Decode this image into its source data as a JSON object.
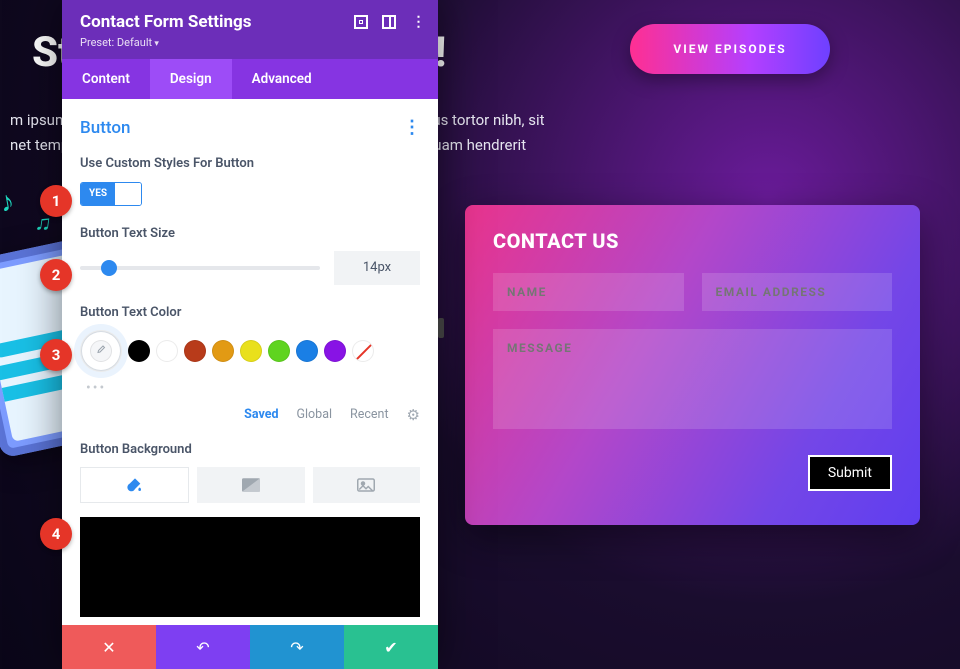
{
  "background": {
    "heading_left": "St",
    "heading_right": "lay!",
    "paragraph_line1_left": "m ipsum",
    "paragraph_line1_right": "rius tortor nibh, sit",
    "paragraph_line2_left": "net temp",
    "paragraph_line2_right": "quam hendrerit",
    "view_episodes": "VIEW EPISODES"
  },
  "contact": {
    "title": "CONTACT US",
    "name_placeholder": "NAME",
    "email_placeholder": "EMAIL ADDRESS",
    "message_placeholder": "MESSAGE",
    "submit": "Submit"
  },
  "markers": {
    "m1": "1",
    "m2": "2",
    "m3": "3",
    "m4": "4"
  },
  "panel": {
    "title": "Contact Form Settings",
    "preset": "Preset: Default",
    "tabs": {
      "content": "Content",
      "design": "Design",
      "advanced": "Advanced"
    },
    "section_title": "Button",
    "fields": {
      "custom_styles_label": "Use Custom Styles For Button",
      "toggle_yes": "YES",
      "text_size_label": "Button Text Size",
      "text_size_value": "14px",
      "text_color_label": "Button Text Color",
      "palette": {
        "saved": "Saved",
        "global": "Global",
        "recent": "Recent"
      },
      "bg_label": "Button Background"
    },
    "colors": {
      "accent": "#2d89ef"
    }
  }
}
